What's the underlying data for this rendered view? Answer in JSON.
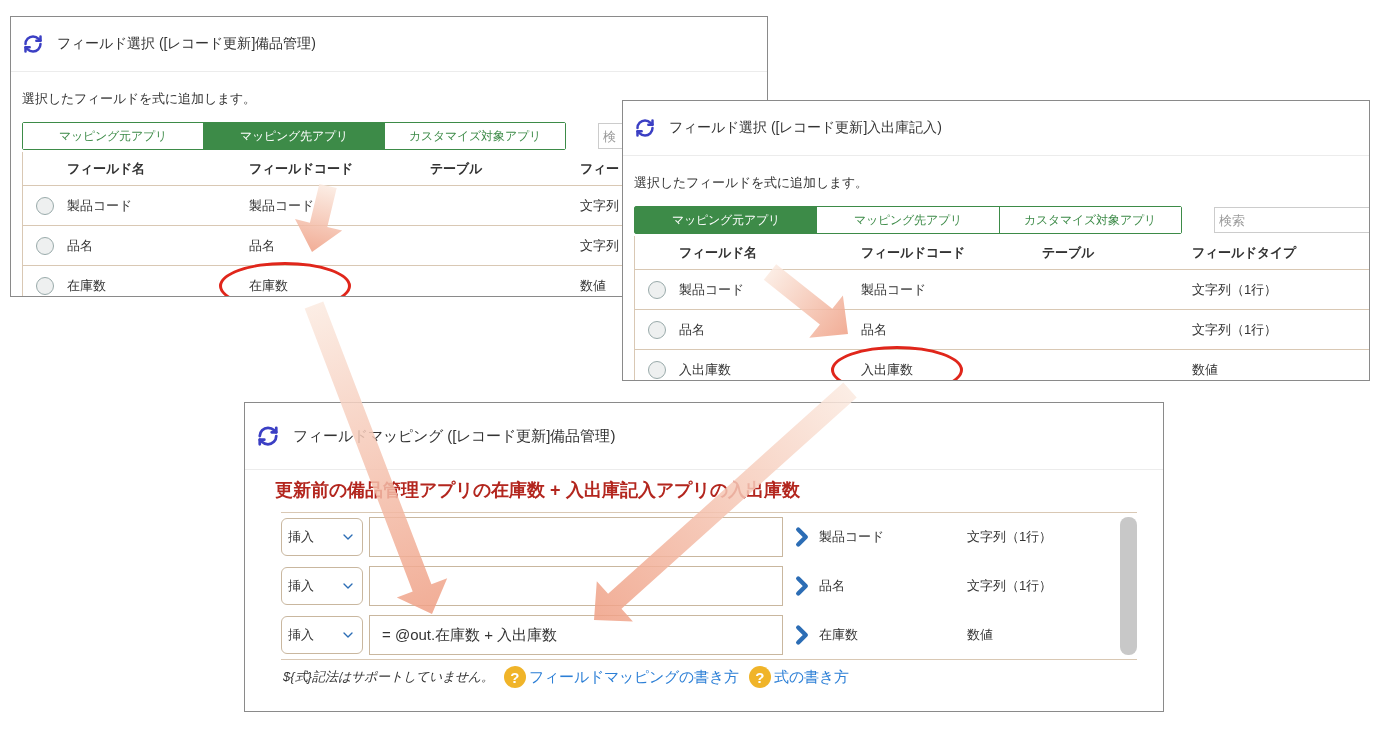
{
  "dialogs": [
    {
      "title": "フィールド選択 ([レコード更新]備品管理)",
      "description": "選択したフィールドを式に追加します。",
      "tabs": [
        {
          "label": "マッピング元アプリ",
          "selected": false
        },
        {
          "label": "マッピング先アプリ",
          "selected": true
        },
        {
          "label": "カスタマイズ対象アプリ",
          "selected": false
        }
      ],
      "search": {
        "placeholder": "検"
      },
      "columns": [
        "フィールド名",
        "フィールドコード",
        "テーブル",
        "フィー"
      ],
      "rows": [
        {
          "selected": false,
          "cells": [
            "製品コード",
            "製品コード",
            "",
            "文字列"
          ]
        },
        {
          "selected": false,
          "cells": [
            "品名",
            "品名",
            "",
            "文字列"
          ]
        },
        {
          "selected": false,
          "cells": [
            "在庫数",
            "在庫数",
            "",
            "数値"
          ],
          "circled": true
        }
      ]
    },
    {
      "title": "フィールド選択 ([レコード更新]入出庫記入)",
      "description": "選択したフィールドを式に追加します。",
      "tabs": [
        {
          "label": "マッピング元アプリ",
          "selected": true
        },
        {
          "label": "マッピング先アプリ",
          "selected": false
        },
        {
          "label": "カスタマイズ対象アプリ",
          "selected": false
        }
      ],
      "search": {
        "placeholder": "検索"
      },
      "columns": [
        "フィールド名",
        "フィールドコード",
        "テーブル",
        "フィールドタイプ"
      ],
      "rows": [
        {
          "selected": false,
          "cells": [
            "製品コード",
            "製品コード",
            "",
            "文字列（1行）"
          ]
        },
        {
          "selected": false,
          "cells": [
            "品名",
            "品名",
            "",
            "文字列（1行）"
          ]
        },
        {
          "selected": false,
          "cells": [
            "入出庫数",
            "入出庫数",
            "",
            "数値"
          ],
          "circled": true
        }
      ]
    }
  ],
  "mapping": {
    "title": "フィールドマッピング ([レコード更新]備品管理)",
    "annotation": "更新前の備品管理アプリの在庫数 + 入出庫記入アプリの入出庫数",
    "rows": [
      {
        "mode": "挿入",
        "field": "製品コード",
        "type": "文字列（1行）"
      },
      {
        "mode": "挿入",
        "field": "品名",
        "type": "文字列（1行）"
      },
      {
        "mode": "挿入",
        "value": "= @out.在庫数 + 入出庫数",
        "field": "在庫数",
        "type": "数値"
      }
    ],
    "note": "${式}記法はサポートしていません。",
    "links": [
      {
        "icon": "?",
        "label": "フィールドマッピングの書き方"
      },
      {
        "icon": "?",
        "label": "式の書き方"
      }
    ]
  }
}
